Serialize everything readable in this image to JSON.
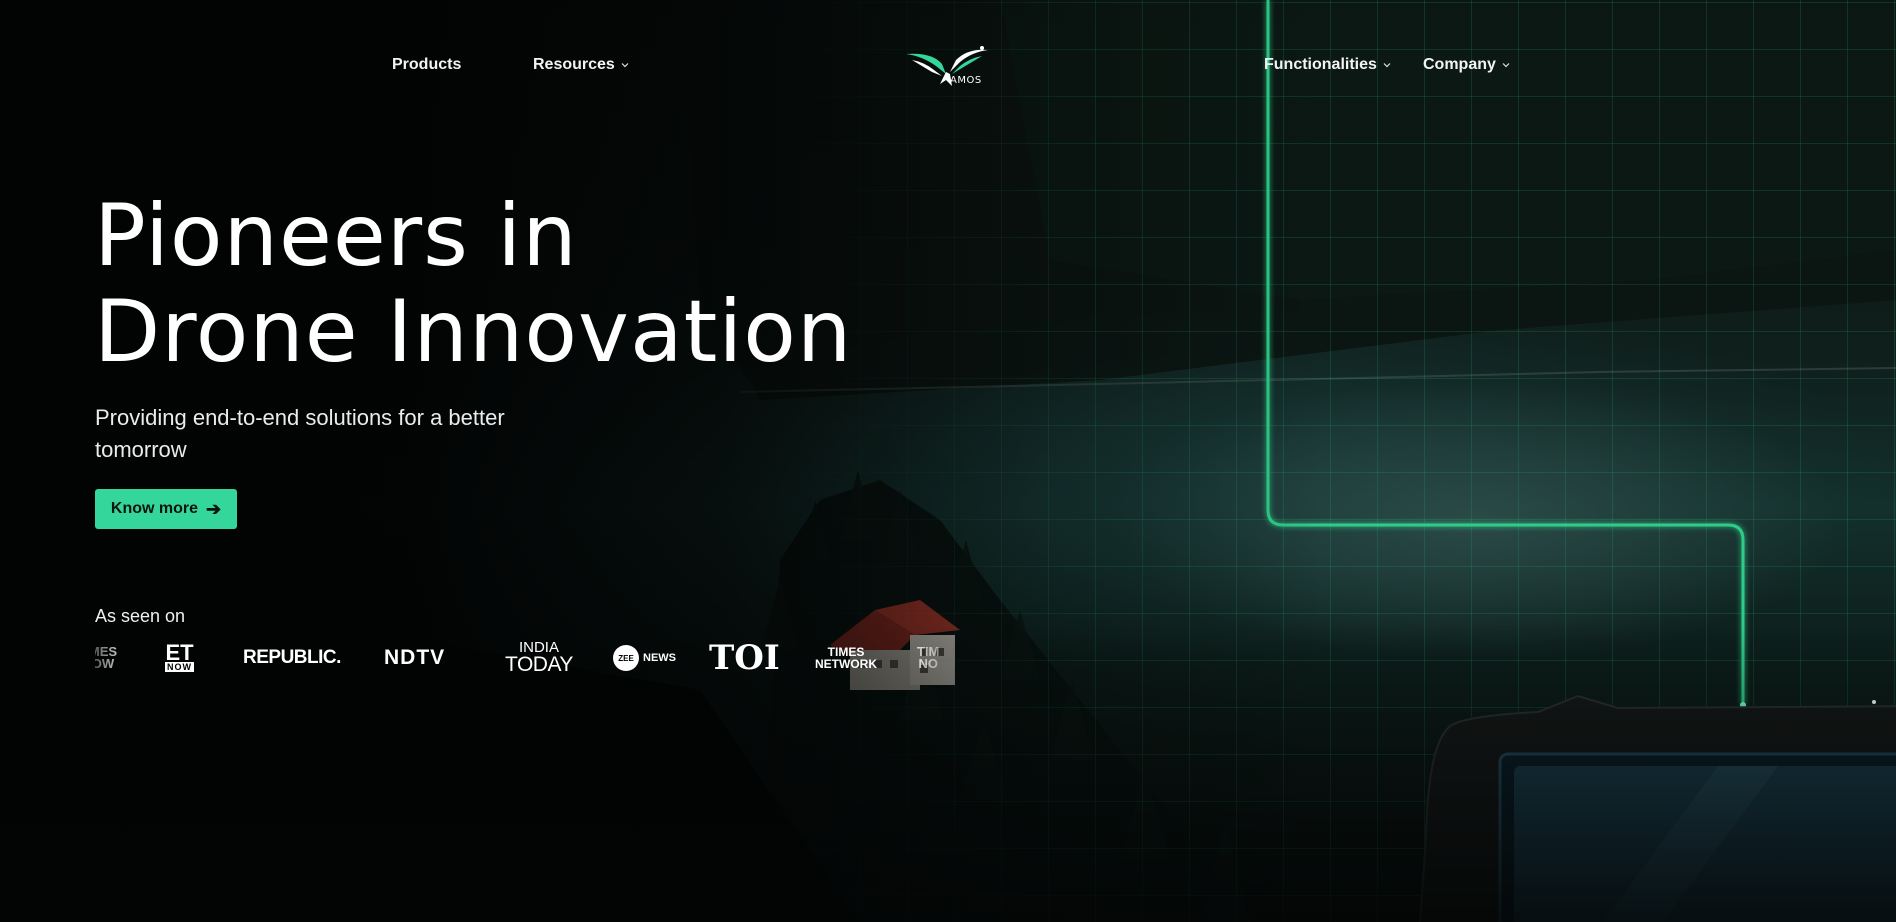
{
  "nav": {
    "left": [
      {
        "label": "Products",
        "has_dropdown": false
      },
      {
        "label": "Resources",
        "has_dropdown": true
      }
    ],
    "right": [
      {
        "label": "Functionalities",
        "has_dropdown": true
      },
      {
        "label": "Company",
        "has_dropdown": true
      }
    ],
    "logo_text": "AMOS",
    "logo_icon": "eagle-logo-icon"
  },
  "hero": {
    "title_line1": "Pioneers in",
    "title_line2": "Drone Innovation",
    "subtitle": "Providing end-to-end solutions for a better tomorrow",
    "cta_label": "Know more",
    "cta_icon": "arrow-right-icon"
  },
  "media": {
    "label": "As seen on",
    "logos": {
      "times_now_partial": {
        "line1": "MES",
        "line2": "OW"
      },
      "et_now": {
        "line1": "ET",
        "line2": "NOW"
      },
      "republic": "REPUBLIC.",
      "ndtv": "NDTV",
      "india_today": {
        "line1": "INDIA",
        "line2": "TODAY"
      },
      "zee_news": {
        "mark": "ZEE",
        "text": "NEWS"
      },
      "toi": "TOI",
      "times_network": {
        "line1": "TIMES",
        "line2": "NETWORK"
      },
      "times_now_partial_right": {
        "line1": "TIM",
        "line2": "NO"
      }
    }
  },
  "colors": {
    "accent": "#35d69b",
    "circuit_glow": "#2ecc88",
    "background": "#050707",
    "text": "#ffffff"
  }
}
